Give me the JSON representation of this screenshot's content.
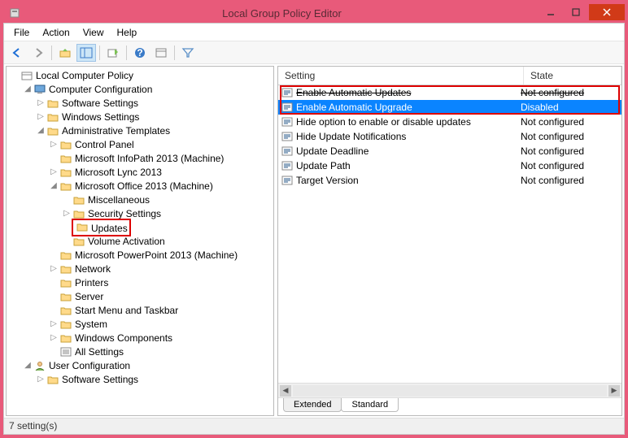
{
  "window": {
    "title": "Local Group Policy Editor"
  },
  "menubar": {
    "items": [
      "File",
      "Action",
      "View",
      "Help"
    ]
  },
  "tree": {
    "root": "Local Computer Policy",
    "computer_config": "Computer Configuration",
    "software_settings": "Software Settings",
    "windows_settings": "Windows Settings",
    "admin_templates": "Administrative Templates",
    "control_panel": "Control Panel",
    "ms_infopath": "Microsoft InfoPath 2013 (Machine)",
    "ms_lync": "Microsoft Lync 2013",
    "ms_office": "Microsoft Office 2013 (Machine)",
    "miscellaneous": "Miscellaneous",
    "security_settings": "Security Settings",
    "updates": "Updates",
    "volume_activation": "Volume Activation",
    "ms_powerpoint": "Microsoft PowerPoint 2013 (Machine)",
    "network": "Network",
    "printers": "Printers",
    "server": "Server",
    "start_menu": "Start Menu and Taskbar",
    "system": "System",
    "windows_components": "Windows Components",
    "all_settings": "All Settings",
    "user_config": "User Configuration",
    "user_software_settings": "Software Settings"
  },
  "list": {
    "header_setting": "Setting",
    "header_state": "State",
    "rows": [
      {
        "name": "Enable Automatic Updates",
        "state": "Not configured",
        "strike": true
      },
      {
        "name": "Enable Automatic Upgrade",
        "state": "Disabled",
        "selected": true
      },
      {
        "name": "Hide option to enable or disable updates",
        "state": "Not configured"
      },
      {
        "name": "Hide Update Notifications",
        "state": "Not configured"
      },
      {
        "name": "Update Deadline",
        "state": "Not configured"
      },
      {
        "name": "Update Path",
        "state": "Not configured"
      },
      {
        "name": "Target Version",
        "state": "Not configured"
      }
    ]
  },
  "tabs": {
    "extended": "Extended",
    "standard": "Standard"
  },
  "status": "7 setting(s)"
}
